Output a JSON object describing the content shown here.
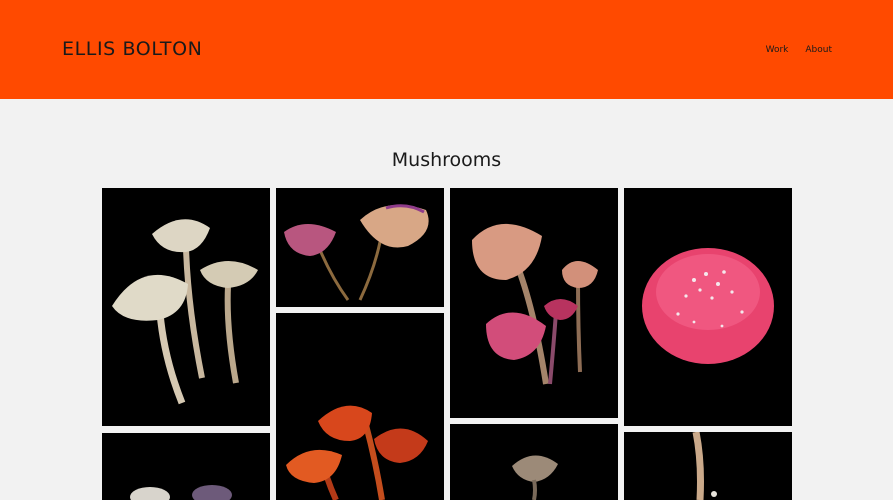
{
  "header": {
    "site_title": "ELLIS BOLTON",
    "nav": [
      {
        "label": "Work"
      },
      {
        "label": "About"
      }
    ],
    "background": "#ff4a00"
  },
  "gallery": {
    "heading": "Mushrooms",
    "photos": [
      {
        "name": "pale-mushroom-cluster"
      },
      {
        "name": "dried-pink-caps"
      },
      {
        "name": "red-orange-waxcaps"
      },
      {
        "name": "pink-mushrooms-trio"
      },
      {
        "name": "fly-agaric-cap"
      },
      {
        "name": "dark-mushroom-partial"
      },
      {
        "name": "brown-mushroom-partial"
      },
      {
        "name": "thin-stalk-partial"
      }
    ]
  }
}
